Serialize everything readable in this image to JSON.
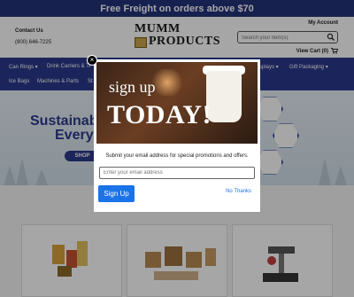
{
  "promo": {
    "text": "Free Freight on orders above $70"
  },
  "header": {
    "contact_title": "Contact Us",
    "phone": "(800) 646-7225",
    "logo_line1": "Mumm",
    "logo_line2": "Products",
    "my_account": "My Account",
    "search_placeholder": "Search your item(s)",
    "view_cart": "View Cart (0)"
  },
  "nav": {
    "items": [
      {
        "label": "Can Rings ▾"
      },
      {
        "label": "Drink Carriers & Tr"
      },
      {
        "label": "splays ▾"
      },
      {
        "label": "Gift Packaging ▾"
      },
      {
        "label": "Ice Bags"
      },
      {
        "label": "Machines & Parts"
      },
      {
        "label": "St"
      }
    ]
  },
  "hero": {
    "line1": "Sustainab",
    "line2": "Every",
    "shop": "SHOP"
  },
  "modal": {
    "title_line1": "sign up",
    "title_line2": "TODAY!",
    "description": "Submit your email address for special promotions and offers.",
    "email_placeholder": "Enter your email address",
    "signup_button": "Sign Up",
    "no_thanks": "No Thanks",
    "close": "×"
  },
  "colors": {
    "brand_navy": "#2b3a8c",
    "promo_navy": "#24337a",
    "button_blue": "#1a73e8"
  }
}
